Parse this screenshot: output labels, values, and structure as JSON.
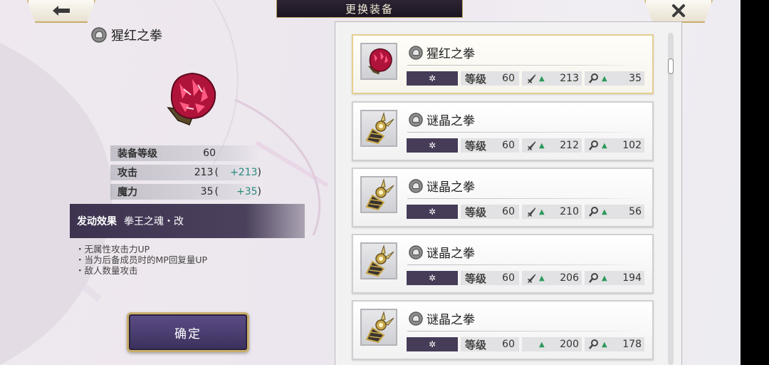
{
  "header": {
    "title": "更换装备",
    "back_icon": "back-arrow-icon",
    "close_icon": "close-icon"
  },
  "detail": {
    "name": "猩红之拳",
    "stats": [
      {
        "label": "装备等级",
        "value": "60",
        "paren_open": "",
        "bonus": "",
        "paren_close": ""
      },
      {
        "label": "攻击",
        "value": "213",
        "paren_open": "(",
        "bonus": "+213",
        "paren_close": ")"
      },
      {
        "label": "魔力",
        "value": "35",
        "paren_open": "(",
        "bonus": "+35",
        "paren_close": ")"
      }
    ],
    "effect_title": "发动效果",
    "effect_name": "拳王之魂・改",
    "effect_lines": [
      "・无属性攻击力UP",
      "・当为后备成员时的MP回复量UP",
      "・敌人数量攻击"
    ],
    "confirm_label": "确定"
  },
  "list": {
    "level_label": "等级",
    "items": [
      {
        "name": "猩红之拳",
        "level": "60",
        "attack": "213",
        "magic": "35",
        "selected": true,
        "kind": "crimson"
      },
      {
        "name": "谜晶之拳",
        "level": "60",
        "attack": "212",
        "magic": "102",
        "selected": false,
        "kind": "crystal"
      },
      {
        "name": "谜晶之拳",
        "level": "60",
        "attack": "210",
        "magic": "56",
        "selected": false,
        "kind": "crystal"
      },
      {
        "name": "谜晶之拳",
        "level": "60",
        "attack": "206",
        "magic": "194",
        "selected": false,
        "kind": "crystal"
      },
      {
        "name": "谜晶之拳",
        "level": "60",
        "attack": "200",
        "magic": "178",
        "selected": false,
        "kind": "crystal"
      }
    ]
  },
  "colors": {
    "accent_gold": "#c9ad6a",
    "stat_up_green": "#2c9a5a",
    "bonus_teal": "#2b8a7a",
    "panel_purple": "#463c58"
  }
}
